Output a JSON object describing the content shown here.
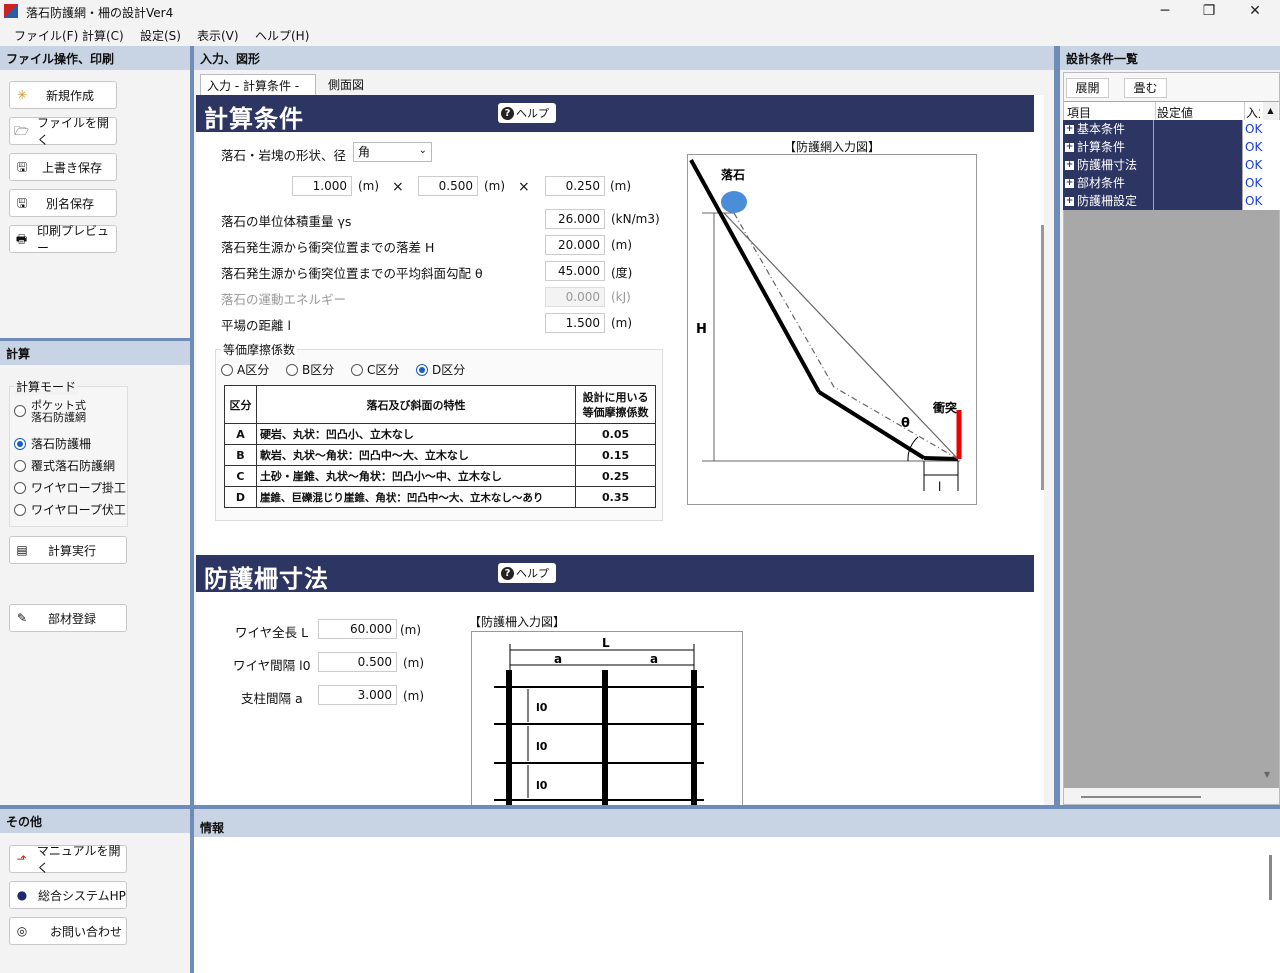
{
  "window": {
    "title": "落石防護網・柵の設計Ver4",
    "minimize": "─",
    "maximize": "❐",
    "close": "✕"
  },
  "menu": [
    "ファイル(F)",
    "計算(C)",
    "設定(S)",
    "表示(V)",
    "ヘルプ(H)"
  ],
  "left_file": {
    "header": "ファイル操作、印刷",
    "buttons": [
      "新規作成",
      "ファイルを開く",
      "上書き保存",
      "別名保存",
      "印刷プレビュー"
    ]
  },
  "left_calc": {
    "header": "計算",
    "mode_label": "計算モード",
    "modes": [
      "ポケット式\n落石防護網",
      "落石防護柵",
      "覆式落石防護網",
      "ワイヤロープ掛工",
      "ワイヤロープ伏工"
    ],
    "selected_mode": 1,
    "run_button": "計算実行",
    "member_button": "部材登録"
  },
  "left_other": {
    "header": "その他",
    "buttons": [
      "マニュアルを開く",
      "総合システムHP",
      "お問い合わせ"
    ]
  },
  "center": {
    "header": "入力、図形",
    "tabs": [
      "入力 - 計算条件 -",
      "側面図"
    ],
    "active_tab": 0
  },
  "calc_section": {
    "title": "計算条件",
    "help": "ヘルプ",
    "shape_label": "落石・岩塊の形状、径",
    "shape_value": "角",
    "dims": [
      "1.000",
      "0.500",
      "0.250"
    ],
    "dim_unit": "(m)",
    "times": "×",
    "rows": [
      {
        "label": "落石の単位体積重量 γs",
        "value": "26.000",
        "unit": "(kN/m3)",
        "disabled": false
      },
      {
        "label": "落石発生源から衝突位置までの落差 H",
        "value": "20.000",
        "unit": "(m)",
        "disabled": false
      },
      {
        "label": "落石発生源から衝突位置までの平均斜面勾配 θ",
        "value": "45.000",
        "unit": "(度)",
        "disabled": false
      },
      {
        "label": "落石の運動エネルギー",
        "value": "0.000",
        "unit": "(kJ)",
        "disabled": true
      },
      {
        "label": "平場の距離 l",
        "value": "1.500",
        "unit": "(m)",
        "disabled": false
      }
    ],
    "friction_group": "等価摩擦係数",
    "friction_options": [
      "A区分",
      "B区分",
      "C区分",
      "D区分"
    ],
    "friction_selected": 3,
    "table_headers": [
      "区分",
      "落石及び斜面の特性",
      "設計に用いる\n等価摩擦係数"
    ],
    "table_rows": [
      [
        "A",
        "硬岩、丸状：凹凸小、立木なし",
        "0.05"
      ],
      [
        "B",
        "軟岩、丸状～角状：凹凸中～大、立木なし",
        "0.15"
      ],
      [
        "C",
        "土砂・崖錐、丸状～角状：凹凸小～中、立木なし",
        "0.25"
      ],
      [
        "D",
        "崖錐、巨礫混じり崖錐、角状：凹凸中～大、立木なし～あり",
        "0.35"
      ]
    ],
    "figure_title": "【防護網入力図】",
    "figure_labels": {
      "rock": "落石",
      "h": "H",
      "theta": "θ",
      "impact": "衝突",
      "l": "l"
    }
  },
  "fence_section": {
    "title": "防護柵寸法",
    "help": "ヘルプ",
    "rows": [
      {
        "label": "ワイヤ全長 L",
        "value": "60.000",
        "unit": "(m)"
      },
      {
        "label": "ワイヤ間隔 l0",
        "value": "0.500",
        "unit": "(m)"
      },
      {
        "label": "支柱間隔 a",
        "value": "3.000",
        "unit": "(m)"
      }
    ],
    "figure_title": "【防護柵入力図】",
    "figure_labels": {
      "L": "L",
      "a": "a",
      "l0": "l0"
    }
  },
  "right": {
    "header": "設計条件一覧",
    "expand": "展開",
    "collapse": "畳む",
    "columns": [
      "項目",
      "設定値",
      "入力"
    ],
    "items": [
      {
        "name": "基本条件",
        "status": "OK"
      },
      {
        "name": "計算条件",
        "status": "OK"
      },
      {
        "name": "防護柵寸法",
        "status": "OK"
      },
      {
        "name": "部材条件",
        "status": "OK"
      },
      {
        "name": "防護柵設定",
        "status": "OK"
      }
    ]
  },
  "info": {
    "header": "情報"
  }
}
